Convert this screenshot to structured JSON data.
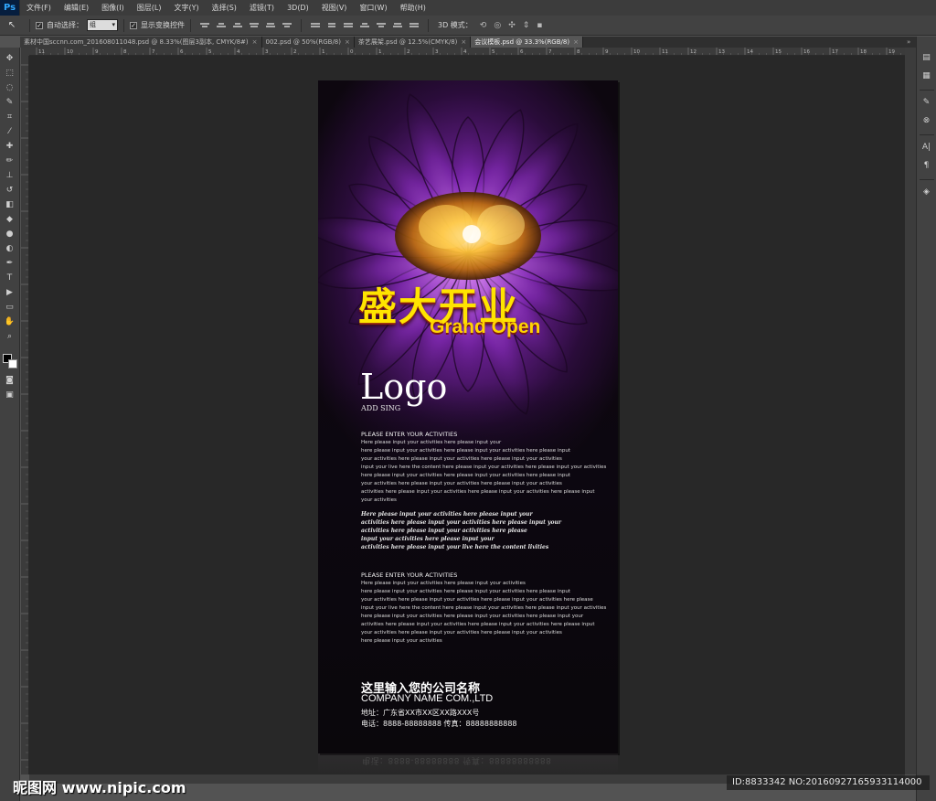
{
  "app": {
    "logo_text": "Ps"
  },
  "menu": [
    "文件(F)",
    "编辑(E)",
    "图像(I)",
    "图层(L)",
    "文字(Y)",
    "选择(S)",
    "滤镜(T)",
    "3D(D)",
    "视图(V)",
    "窗口(W)",
    "帮助(H)"
  ],
  "options": {
    "tool_glyph": "↖",
    "auto_select_label": "自动选择：",
    "auto_select_value": "组",
    "auto_select_checked": true,
    "show_transform_label": "显示变换控件",
    "show_transform_checked": true,
    "mode_3d_label": "3D 模式："
  },
  "tabs": [
    {
      "label": "素材中国sccnn.com_201608011048.psd @ 8.33%(图层3副本, CMYK/8#)",
      "active": false
    },
    {
      "label": "002.psd @ 50%(RGB/8)",
      "active": false
    },
    {
      "label": "茶艺展架.psd @ 12.5%(CMYK/8)",
      "active": false
    },
    {
      "label": "会议模板.psd @ 33.3%(RGB/8)",
      "active": true
    }
  ],
  "ruler_top_ticks": [
    "11",
    "10",
    "9",
    "8",
    "7",
    "6",
    "5",
    "4",
    "3",
    "2",
    "1",
    "0",
    "1",
    "2",
    "3",
    "4",
    "5",
    "6",
    "7",
    "8",
    "9",
    "10",
    "11",
    "12",
    "13",
    "14",
    "15",
    "16",
    "17",
    "18",
    "19"
  ],
  "poster": {
    "title_cn": "盛大开业",
    "title_en": "Grand Open",
    "logo": "Logo",
    "logo_sub": "ADD SING",
    "section1_title": "PLEASE ENTER YOUR ACTIVITIES",
    "section1_lines": [
      "Here please input your activities here please input your",
      "here please input your activities here please input your activities here please input",
      "your activities here please input your activities here please input your activities",
      "input your live here the content here please input your activities here please input your activities",
      "here please input your activities here please input your activities here please input",
      "your activities here please input your activities here please input your activities",
      "activities here please input your activities here please input your activities here please input",
      "your activities"
    ],
    "section2_lines": [
      "Here please input your activities here please input your",
      "activities here please input your activities here please input your",
      "activities here please input your activities here please",
      "input your activities here please input your",
      "activities here please input your live here the content livities"
    ],
    "section3_title": "PLEASE ENTER YOUR ACTIVITIES",
    "section3_lines": [
      "Here please input your activities here please input your activities",
      "here please input your activities here please input your activities here please input",
      "your activities here please input your activities here please input your activities here please",
      "input your live here the content here please input your activities here please input your activities",
      "here please input your activities here please input your activities here please input your",
      "activities here please input your activities here please input your activities here please input",
      "your activities here please input your activities here please input your activities",
      "here please input your activities"
    ],
    "company_cn": "这里输入您的公司名称",
    "company_en": "COMPANY NAME COM.,LTD",
    "address": "地址：广东省XX市XX区XX路XXX号",
    "tel": "电话：8888-88888888  传真：88888888888"
  },
  "watermark_left": "昵图网 www.nipic.com",
  "watermark_right": "ID:8833342 NO:20160927165933114000",
  "colors": {
    "title_yellow": "#ffe400",
    "accent_purple": "#9b3fd1",
    "ps_blue": "#31a8ff"
  }
}
